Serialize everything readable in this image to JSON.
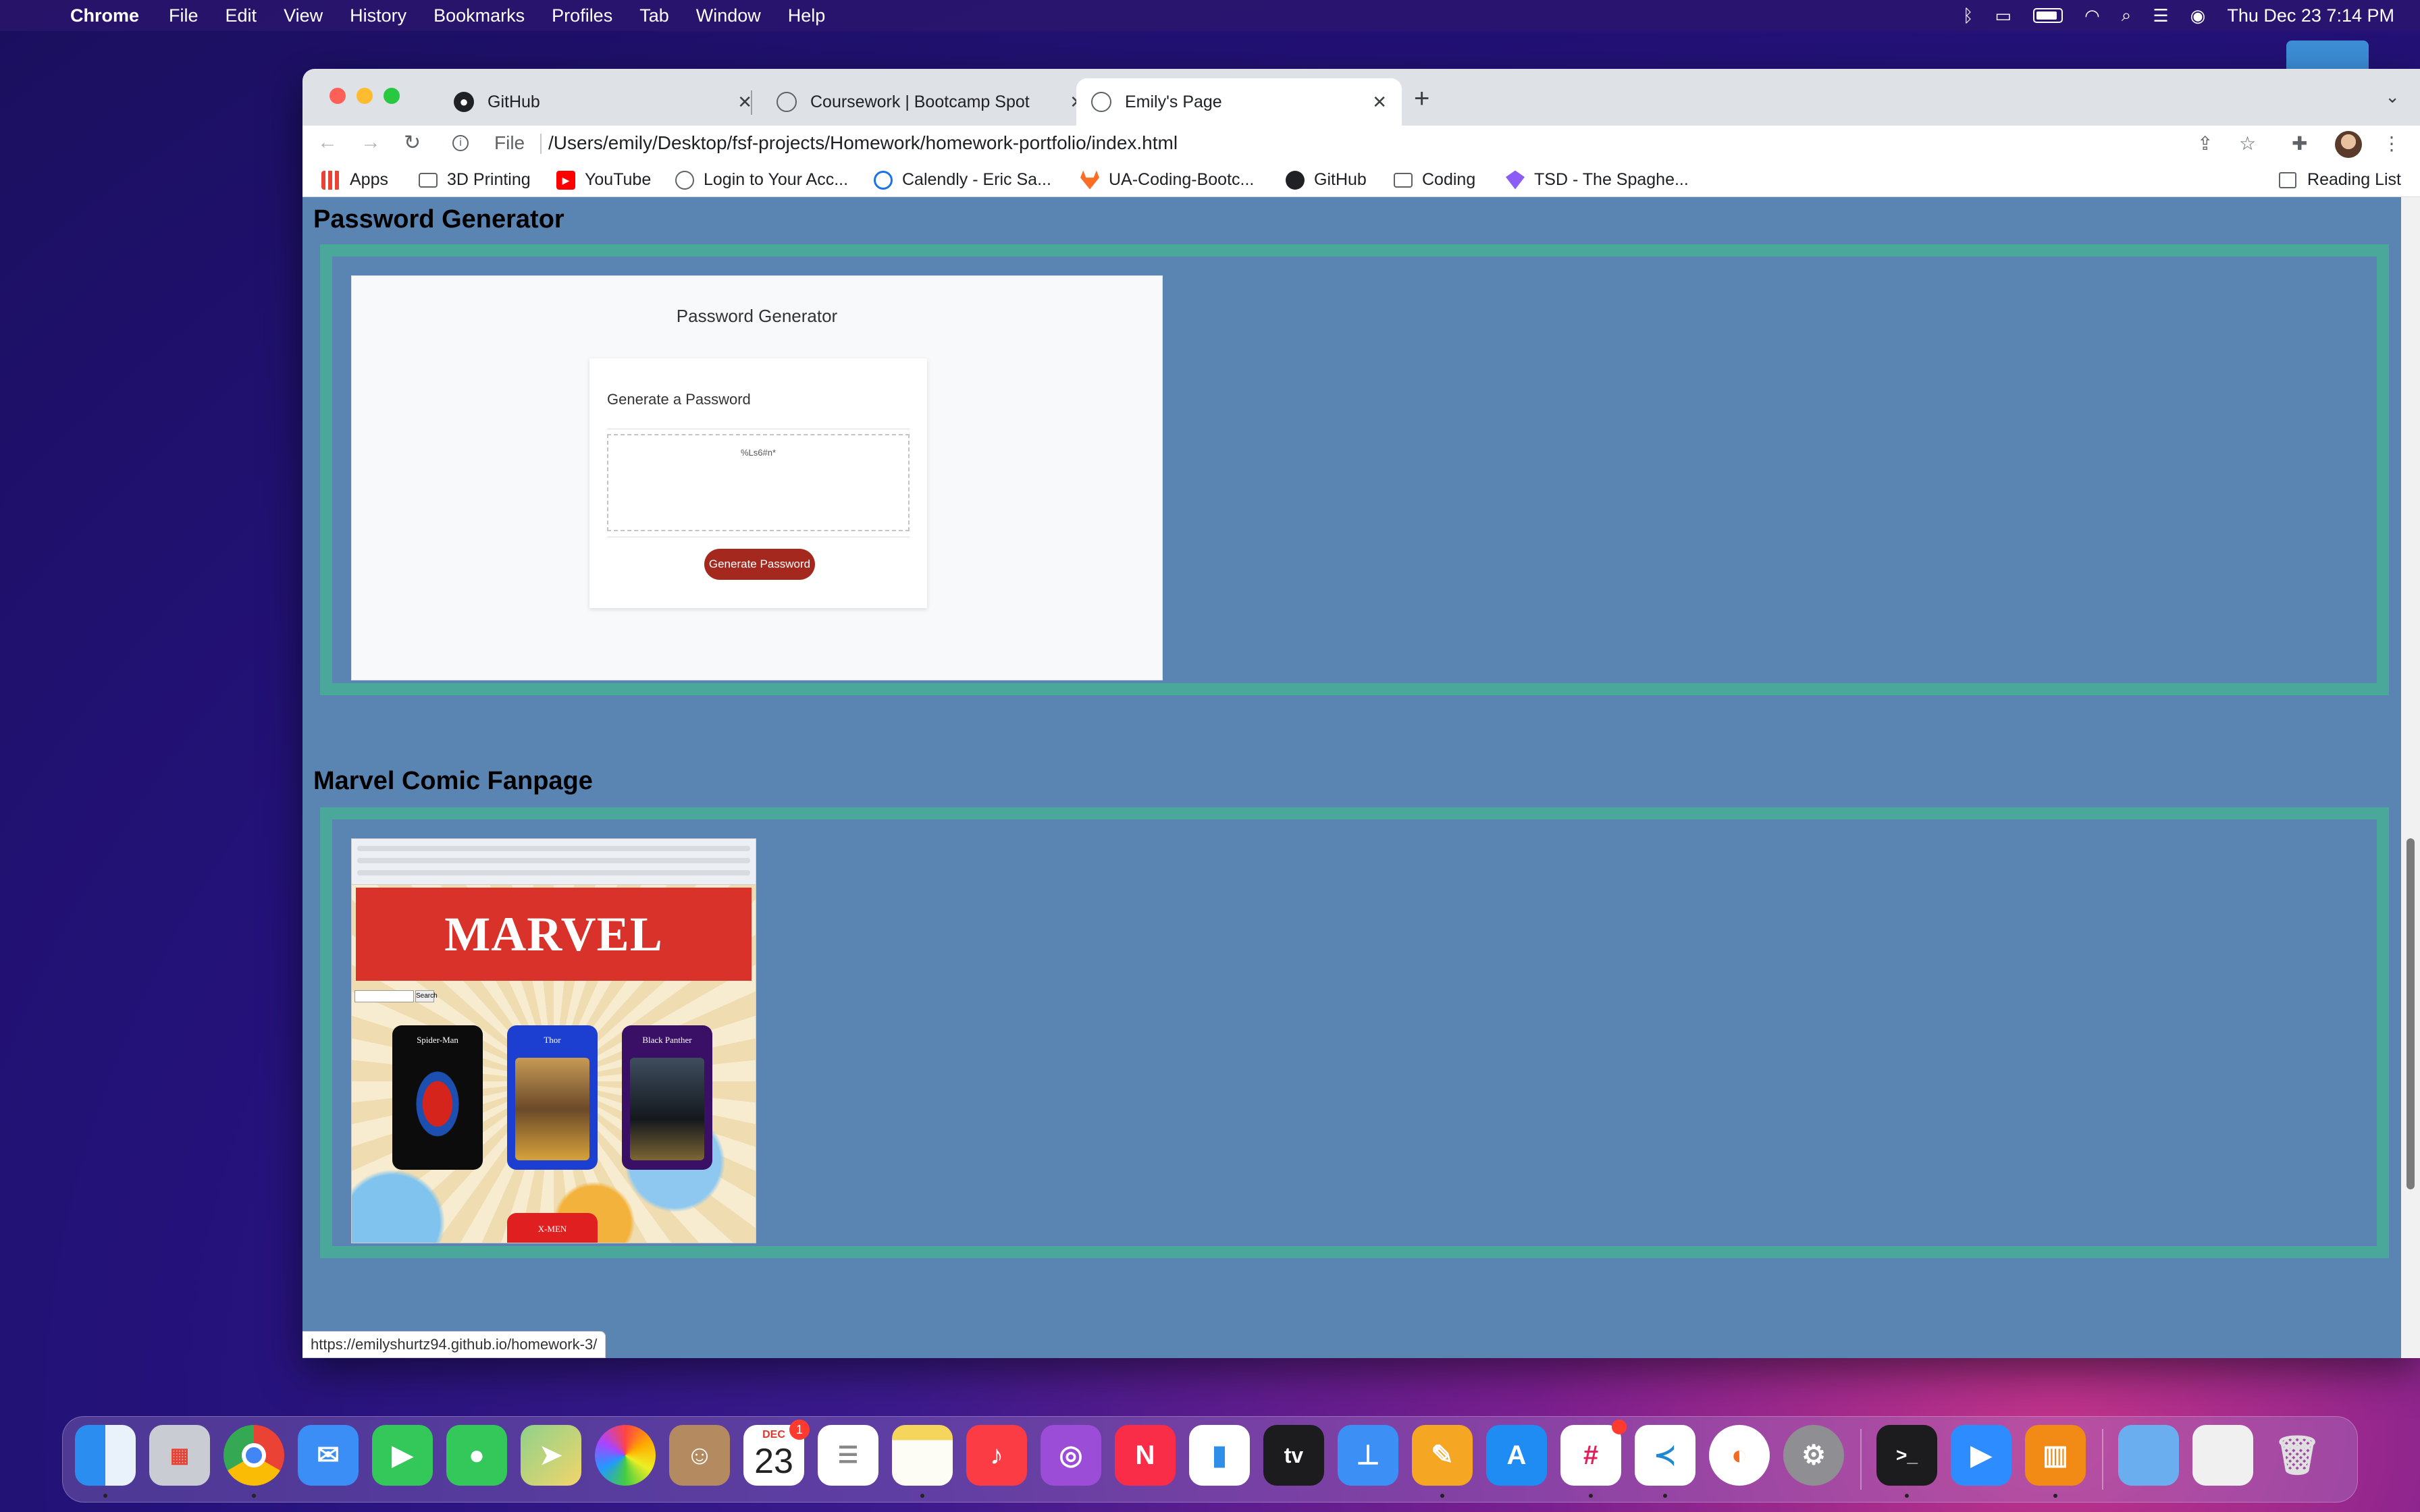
{
  "menubar": {
    "app": "Chrome",
    "items": [
      "File",
      "Edit",
      "View",
      "History",
      "Bookmarks",
      "Profiles",
      "Tab",
      "Window",
      "Help"
    ],
    "clock": "Thu Dec 23  7:14 PM"
  },
  "browser": {
    "tabs": [
      {
        "title": "GitHub",
        "icon": "github-icon"
      },
      {
        "title": "Coursework | Bootcamp Spot",
        "icon": "globe-icon"
      },
      {
        "title": "Emily's Page",
        "icon": "globe-icon",
        "active": true
      }
    ],
    "url_scheme": "File",
    "url": "/Users/emily/Desktop/fsf-projects/Homework/homework-portfolio/index.html",
    "bookmarks": [
      {
        "label": "Apps",
        "icon": "apps-grid-icon"
      },
      {
        "label": "3D Printing",
        "icon": "folder-icon"
      },
      {
        "label": "YouTube",
        "icon": "youtube-icon"
      },
      {
        "label": "Login to Your Acc...",
        "icon": "globe-icon"
      },
      {
        "label": "Calendly - Eric Sa...",
        "icon": "calendly-icon"
      },
      {
        "label": "UA-Coding-Bootc...",
        "icon": "gitlab-icon"
      },
      {
        "label": "GitHub",
        "icon": "github-icon"
      },
      {
        "label": "Coding",
        "icon": "folder-icon"
      },
      {
        "label": "TSD - The Spaghe...",
        "icon": "tsd-icon"
      }
    ],
    "reading_list": "Reading List",
    "status_url": "https://emilyshurtz94.github.io/homework-3/"
  },
  "page": {
    "sections": [
      {
        "title": "Password Generator",
        "preview": {
          "heading": "Password Generator",
          "card_title": "Generate a Password",
          "password_value": "%Ls6#n*",
          "button_label": "Generate Password"
        }
      },
      {
        "title": "Marvel Comic Fanpage",
        "preview": {
          "banner": "MARVEL",
          "search_button": "Search",
          "cards": [
            "Spider-Man",
            "Thor",
            "Black Panther"
          ],
          "extra_card": "X-MEN"
        }
      }
    ]
  },
  "dock": {
    "calendar_month": "DEC",
    "calendar_day": "23",
    "calendar_badge": "1",
    "apps": [
      "Finder",
      "Launchpad",
      "Chrome",
      "Mail",
      "FaceTime",
      "Messages",
      "Maps",
      "Photos",
      "Contacts",
      "Calendar",
      "Reminders",
      "Notes",
      "Music",
      "Podcasts",
      "News",
      "Numbers",
      "TV",
      "Keynote",
      "Pages",
      "App Store",
      "Slack",
      "VS Code",
      "Sketch",
      "System Preferences",
      "Terminal",
      "Zoom",
      "Books",
      "Downloads",
      "Documents",
      "Trash"
    ],
    "tv_label": "tv"
  }
}
